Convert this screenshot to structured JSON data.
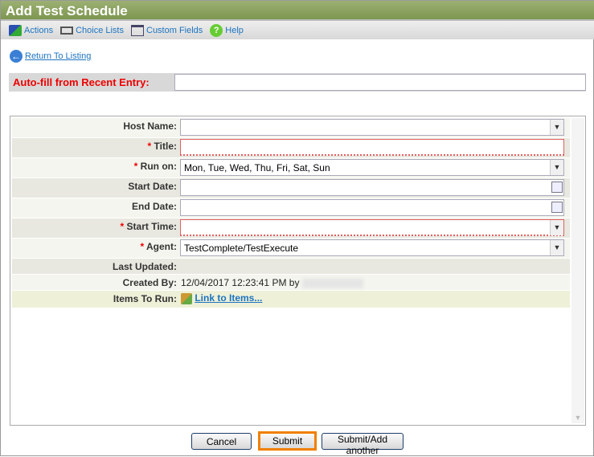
{
  "title": "Add Test Schedule",
  "toolbar": {
    "actions": "Actions",
    "choice_lists": "Choice Lists",
    "custom_fields": "Custom Fields",
    "help": "Help"
  },
  "return_link": "Return To Listing",
  "autofill": {
    "label": "Auto-fill from Recent Entry:",
    "value": ""
  },
  "form": {
    "host_name": {
      "label": "Host Name:",
      "value": ""
    },
    "title": {
      "label": "Title:",
      "value": ""
    },
    "run_on": {
      "label": "Run on:",
      "value": "Mon, Tue, Wed, Thu, Fri, Sat, Sun"
    },
    "start_date": {
      "label": "Start Date:",
      "value": ""
    },
    "end_date": {
      "label": "End Date:",
      "value": ""
    },
    "start_time": {
      "label": "Start Time:",
      "value": ""
    },
    "agent": {
      "label": "Agent:",
      "value": "TestComplete/TestExecute"
    },
    "last_updated": {
      "label": "Last Updated:",
      "value": ""
    },
    "created_by": {
      "label": "Created By:",
      "value": "12/04/2017 12:23:41 PM by"
    },
    "items_to_run": {
      "label": "Items To Run:",
      "link": "Link to Items..."
    },
    "required_marker": "*"
  },
  "buttons": {
    "cancel": "Cancel",
    "submit": "Submit",
    "submit_add": "Submit/Add another"
  }
}
